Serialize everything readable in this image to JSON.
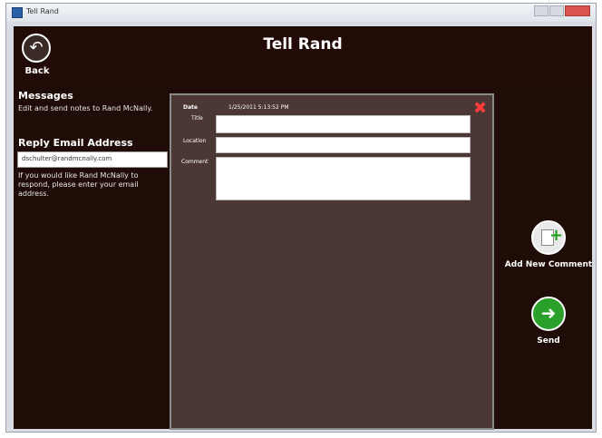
{
  "window": {
    "title": "Tell Rand"
  },
  "header": {
    "title": "Tell Rand",
    "back_label": "Back"
  },
  "sidebar": {
    "messages_heading": "Messages",
    "messages_text": "Edit and send notes to Rand McNally.",
    "reply_heading": "Reply Email Address",
    "email_value": "dschulter@randmcnally.com",
    "help_text": "If you would like Rand McNally to respond, please enter your email address."
  },
  "form": {
    "date_label": "Date",
    "date_value": "1/25/2011 5:13:52 PM",
    "title_label": "Title",
    "location_label": "Location",
    "comment_label": "Comment",
    "title_value": "",
    "location_value": "",
    "comment_value": ""
  },
  "actions": {
    "add_comment_label": "Add New Comment",
    "send_label": "Send"
  },
  "colors": {
    "app_bg": "#200c07",
    "panel_bg": "#4b3835",
    "close_x": "#ff3b3b",
    "send_green": "#2aa02a"
  }
}
